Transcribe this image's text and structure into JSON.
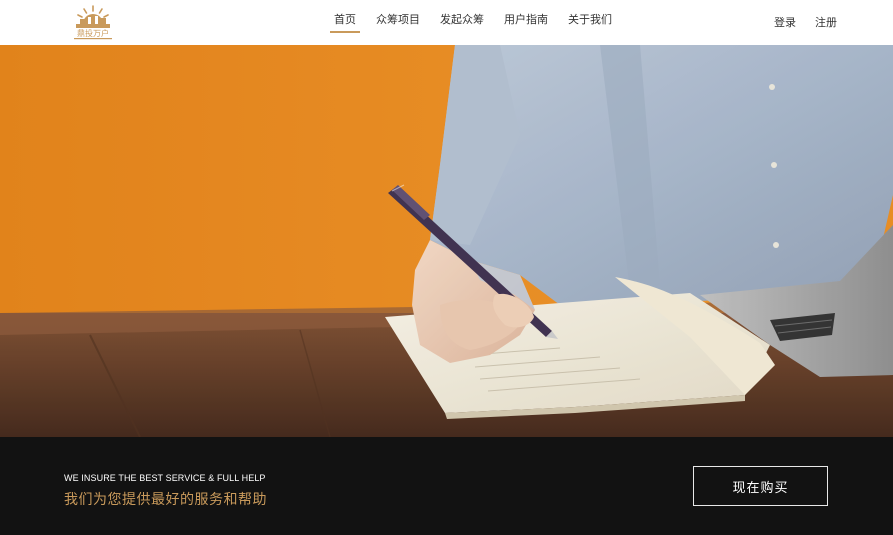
{
  "header": {
    "logo_text": "鼎投万户",
    "nav": [
      {
        "label": "首页",
        "active": true
      },
      {
        "label": "众筹项目",
        "active": false
      },
      {
        "label": "发起众筹",
        "active": false
      },
      {
        "label": "用户指南",
        "active": false
      },
      {
        "label": "关于我们",
        "active": false
      }
    ],
    "login_label": "登录",
    "register_label": "注册"
  },
  "footer_bar": {
    "tagline_en": "WE INSURE THE BEST SERVICE & FULL HELP",
    "tagline_cn": "我们为您提供最好的服务和帮助",
    "cta_label": "现在购买"
  },
  "colors": {
    "accent": "#c99a5b",
    "bar_background": "#121212",
    "hero_orange": "#e7891d"
  },
  "icons": {
    "logo": "sun-city-logo"
  }
}
